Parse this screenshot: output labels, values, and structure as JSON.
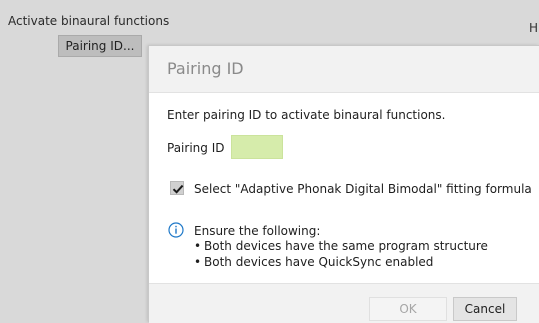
{
  "background": {
    "section_label": "Activate binaural functions",
    "edge_letter": "H",
    "pairing_button_label": "Pairing ID..."
  },
  "dialog": {
    "title": "Pairing ID",
    "instruction": "Enter pairing ID to activate binaural functions.",
    "pairing_id_label": "Pairing ID",
    "pairing_id_value": "",
    "checkbox_checked": true,
    "checkbox_label": "Select \"Adaptive Phonak Digital Bimodal\" fitting formula",
    "info_icon": "info-circle-icon",
    "info_title": "Ensure the following:",
    "bullets": [
      "Both devices have the same program structure",
      "Both devices have QuickSync enabled"
    ],
    "ok_label": "OK",
    "ok_enabled": false,
    "cancel_label": "Cancel"
  },
  "colors": {
    "input_fill": "#d6ecab",
    "info_blue": "#1e78c8",
    "checkmark": "#1a1a1a"
  }
}
